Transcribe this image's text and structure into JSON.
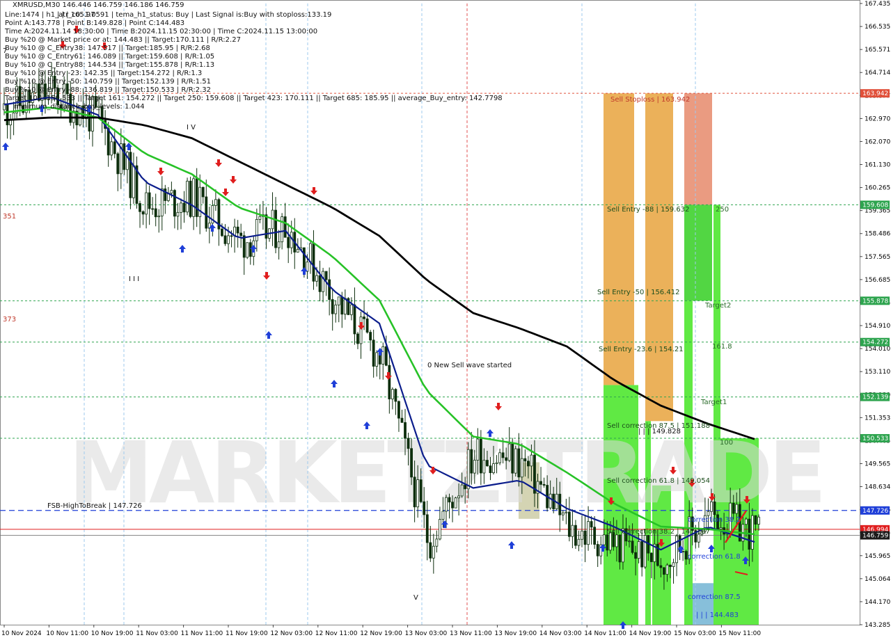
{
  "header": {
    "symbol_line": "XMRUSD,M30  146.446 146.759 146.186 146.759",
    "lines": [
      "Line:1474 | h1_atr_c0: 1.0591 | tema_h1_status: Buy | Last Signal is:Buy with stoploss:133.19",
      "Point A:143.778 | Point B:149.828 | Point C:144.483",
      "Time A:2024.11.14 18:30:00 | Time B:2024.11.15 02:30:00 | Time C:2024.11.15 13:00:00",
      "Buy %20 @ Market price or at: 144.483 || Target:170.111 | R/R:2.27",
      "Buy %10 @ C_Entry38: 147.517 || Target:185.95 | R/R:2.68",
      "Buy %10 @ C_Entry61: 146.089 || Target:159.608 | R/R:1.05",
      "Buy %10 @ C_Entry88: 144.534 || Target:155.878 | R/R:1.13",
      "Buy %10 @ Entry -23: 142.35 || Target:154.272 | R/R:1.3",
      "Buy %10 @ Entry -50: 140.759 || Target:152.139 | R/R:1.51",
      "Buy %10 @ Entry -88: 136.819 || Target:150.533 | R/R:2.32",
      "Target 100: 150.533 || Target 161: 154.272 || Target 250: 159.608 || Target 423: 170.111 || Target 685: 185.95 || average_Buy_entry: 142.7798",
      "minimum_distance_buy_levels: 1.044"
    ]
  },
  "watermark": "MARKETZITRADE",
  "price_axis": {
    "ticks": [
      "167.435",
      "166.535",
      "165.571",
      "164.714",
      "163.877",
      "162.970",
      "162.070",
      "161.130",
      "160.265",
      "159.365",
      "158.486",
      "157.565",
      "156.685",
      "155.725",
      "154.910",
      "154.010",
      "153.110",
      "152.139",
      "151.353",
      "150.405",
      "149.565",
      "148.634",
      "147.726",
      "146.795",
      "145.965",
      "145.064",
      "144.170",
      "143.285"
    ],
    "tags": [
      {
        "label": "163.942",
        "value": 163.942,
        "color": "#e0503a"
      },
      {
        "label": "159.608",
        "value": 159.608,
        "color": "#2ea44f"
      },
      {
        "label": "155.878",
        "value": 155.878,
        "color": "#2ea44f"
      },
      {
        "label": "154.272",
        "value": 154.272,
        "color": "#2ea44f"
      },
      {
        "label": "152.139",
        "value": 152.139,
        "color": "#2ea44f"
      },
      {
        "label": "150.533",
        "value": 150.533,
        "color": "#2ea44f"
      },
      {
        "label": "147.726",
        "value": 147.726,
        "color": "#1f3fd8"
      },
      {
        "label": "146.994",
        "value": 146.994,
        "color": "#e01e1e"
      },
      {
        "label": "146.759",
        "value": 146.759,
        "color": "#1c1c1c"
      }
    ]
  },
  "time_axis": [
    "10 Nov 2024",
    "10 Nov 11:00",
    "10 Nov 19:00",
    "11 Nov 03:00",
    "11 Nov 11:00",
    "11 Nov 19:00",
    "12 Nov 03:00",
    "12 Nov 11:00",
    "12 Nov 19:00",
    "13 Nov 03:00",
    "13 Nov 11:00",
    "13 Nov 19:00",
    "14 Nov 03:00",
    "14 Nov 11:00",
    "14 Nov 19:00",
    "15 Nov 03:00",
    "15 Nov 11:00"
  ],
  "levels": [
    {
      "label": "Sell Stoploss | 163.942",
      "value": 163.942
    },
    {
      "label": "Sell Entry -88 | 159.632",
      "value": 159.608
    },
    {
      "label": "Sell Entry -50 | 156.412",
      "value": 155.878
    },
    {
      "label": "Sell Entry -23.6 | 154.21",
      "value": 154.272
    },
    {
      "label": "Sell correction 87.5 | 151.188",
      "value": 151.188
    },
    {
      "label": "Sell correction 61.8 | 149.054",
      "value": 149.054
    },
    {
      "label": "Sell correction 38.2 | 147.187",
      "value": 147.187
    }
  ],
  "zone_labels": {
    "t250": "250",
    "target2": "Target2",
    "t161": "161.8",
    "target1": "Target1",
    "t100": "100",
    "corr38": "correction 38.2",
    "corr61": "correction 61.8",
    "corr87": "correction 87.5",
    "pointB": "| | | 149.828",
    "pointC": "| | | 144.483",
    "pointTop": "| | | 165.97"
  },
  "annotations": {
    "new_wave": "0 New Sell wave started",
    "fsb": "FSB-HighToBreak | 147.726",
    "wave_iv": "I V",
    "wave_iii": "I I I",
    "wave_v": "V",
    "left_351": "351",
    "left_373": "373",
    "left_7": "7"
  },
  "chart_data": {
    "type": "candlestick",
    "symbol": "XMRUSD",
    "timeframe": "M30",
    "ylim": [
      143.285,
      167.435
    ],
    "x": [
      "10 Nov 2024",
      "10 Nov 11:00",
      "10 Nov 19:00",
      "11 Nov 03:00",
      "11 Nov 11:00",
      "11 Nov 19:00",
      "12 Nov 03:00",
      "12 Nov 11:00",
      "12 Nov 19:00",
      "13 Nov 03:00",
      "13 Nov 11:00",
      "13 Nov 19:00",
      "14 Nov 03:00",
      "14 Nov 11:00",
      "14 Nov 19:00",
      "15 Nov 03:00",
      "15 Nov 11:00"
    ],
    "close_approx": [
      163.3,
      164.0,
      162.9,
      159.6,
      159.9,
      158.2,
      158.8,
      156.0,
      153.6,
      146.5,
      150.0,
      149.6,
      147.0,
      146.4,
      145.8,
      147.6,
      146.8
    ],
    "series": [
      {
        "name": "Blue MA",
        "values": [
          163.5,
          163.8,
          163.1,
          160.5,
          159.6,
          158.3,
          158.6,
          156.3,
          155.0,
          149.5,
          148.6,
          148.9,
          147.8,
          147.1,
          146.2,
          147.1,
          146.5
        ]
      },
      {
        "name": "Green MA",
        "values": [
          163.2,
          163.4,
          163.0,
          161.6,
          160.8,
          159.5,
          158.9,
          157.6,
          155.9,
          152.4,
          150.6,
          150.3,
          149.2,
          148.0,
          147.1,
          147.0,
          146.8
        ]
      },
      {
        "name": "Black MA",
        "values": [
          162.9,
          163.0,
          163.0,
          162.7,
          162.2,
          161.3,
          160.4,
          159.5,
          158.4,
          156.7,
          155.4,
          154.8,
          154.1,
          152.8,
          151.8,
          151.1,
          150.5
        ]
      }
    ],
    "current_price": 146.759,
    "bid_price": 146.994
  },
  "colors": {
    "stoploss_zone": "#e89a3c",
    "entry_zone_orange": "#e8a33d",
    "green_zone": "#3fd12f",
    "bright_green": "#57e83a",
    "blue_ma": "#0b1d8c",
    "green_ma": "#27c227",
    "black_ma": "#000000",
    "bull": "#0a3d0a",
    "bear": "#0a3d0a"
  }
}
